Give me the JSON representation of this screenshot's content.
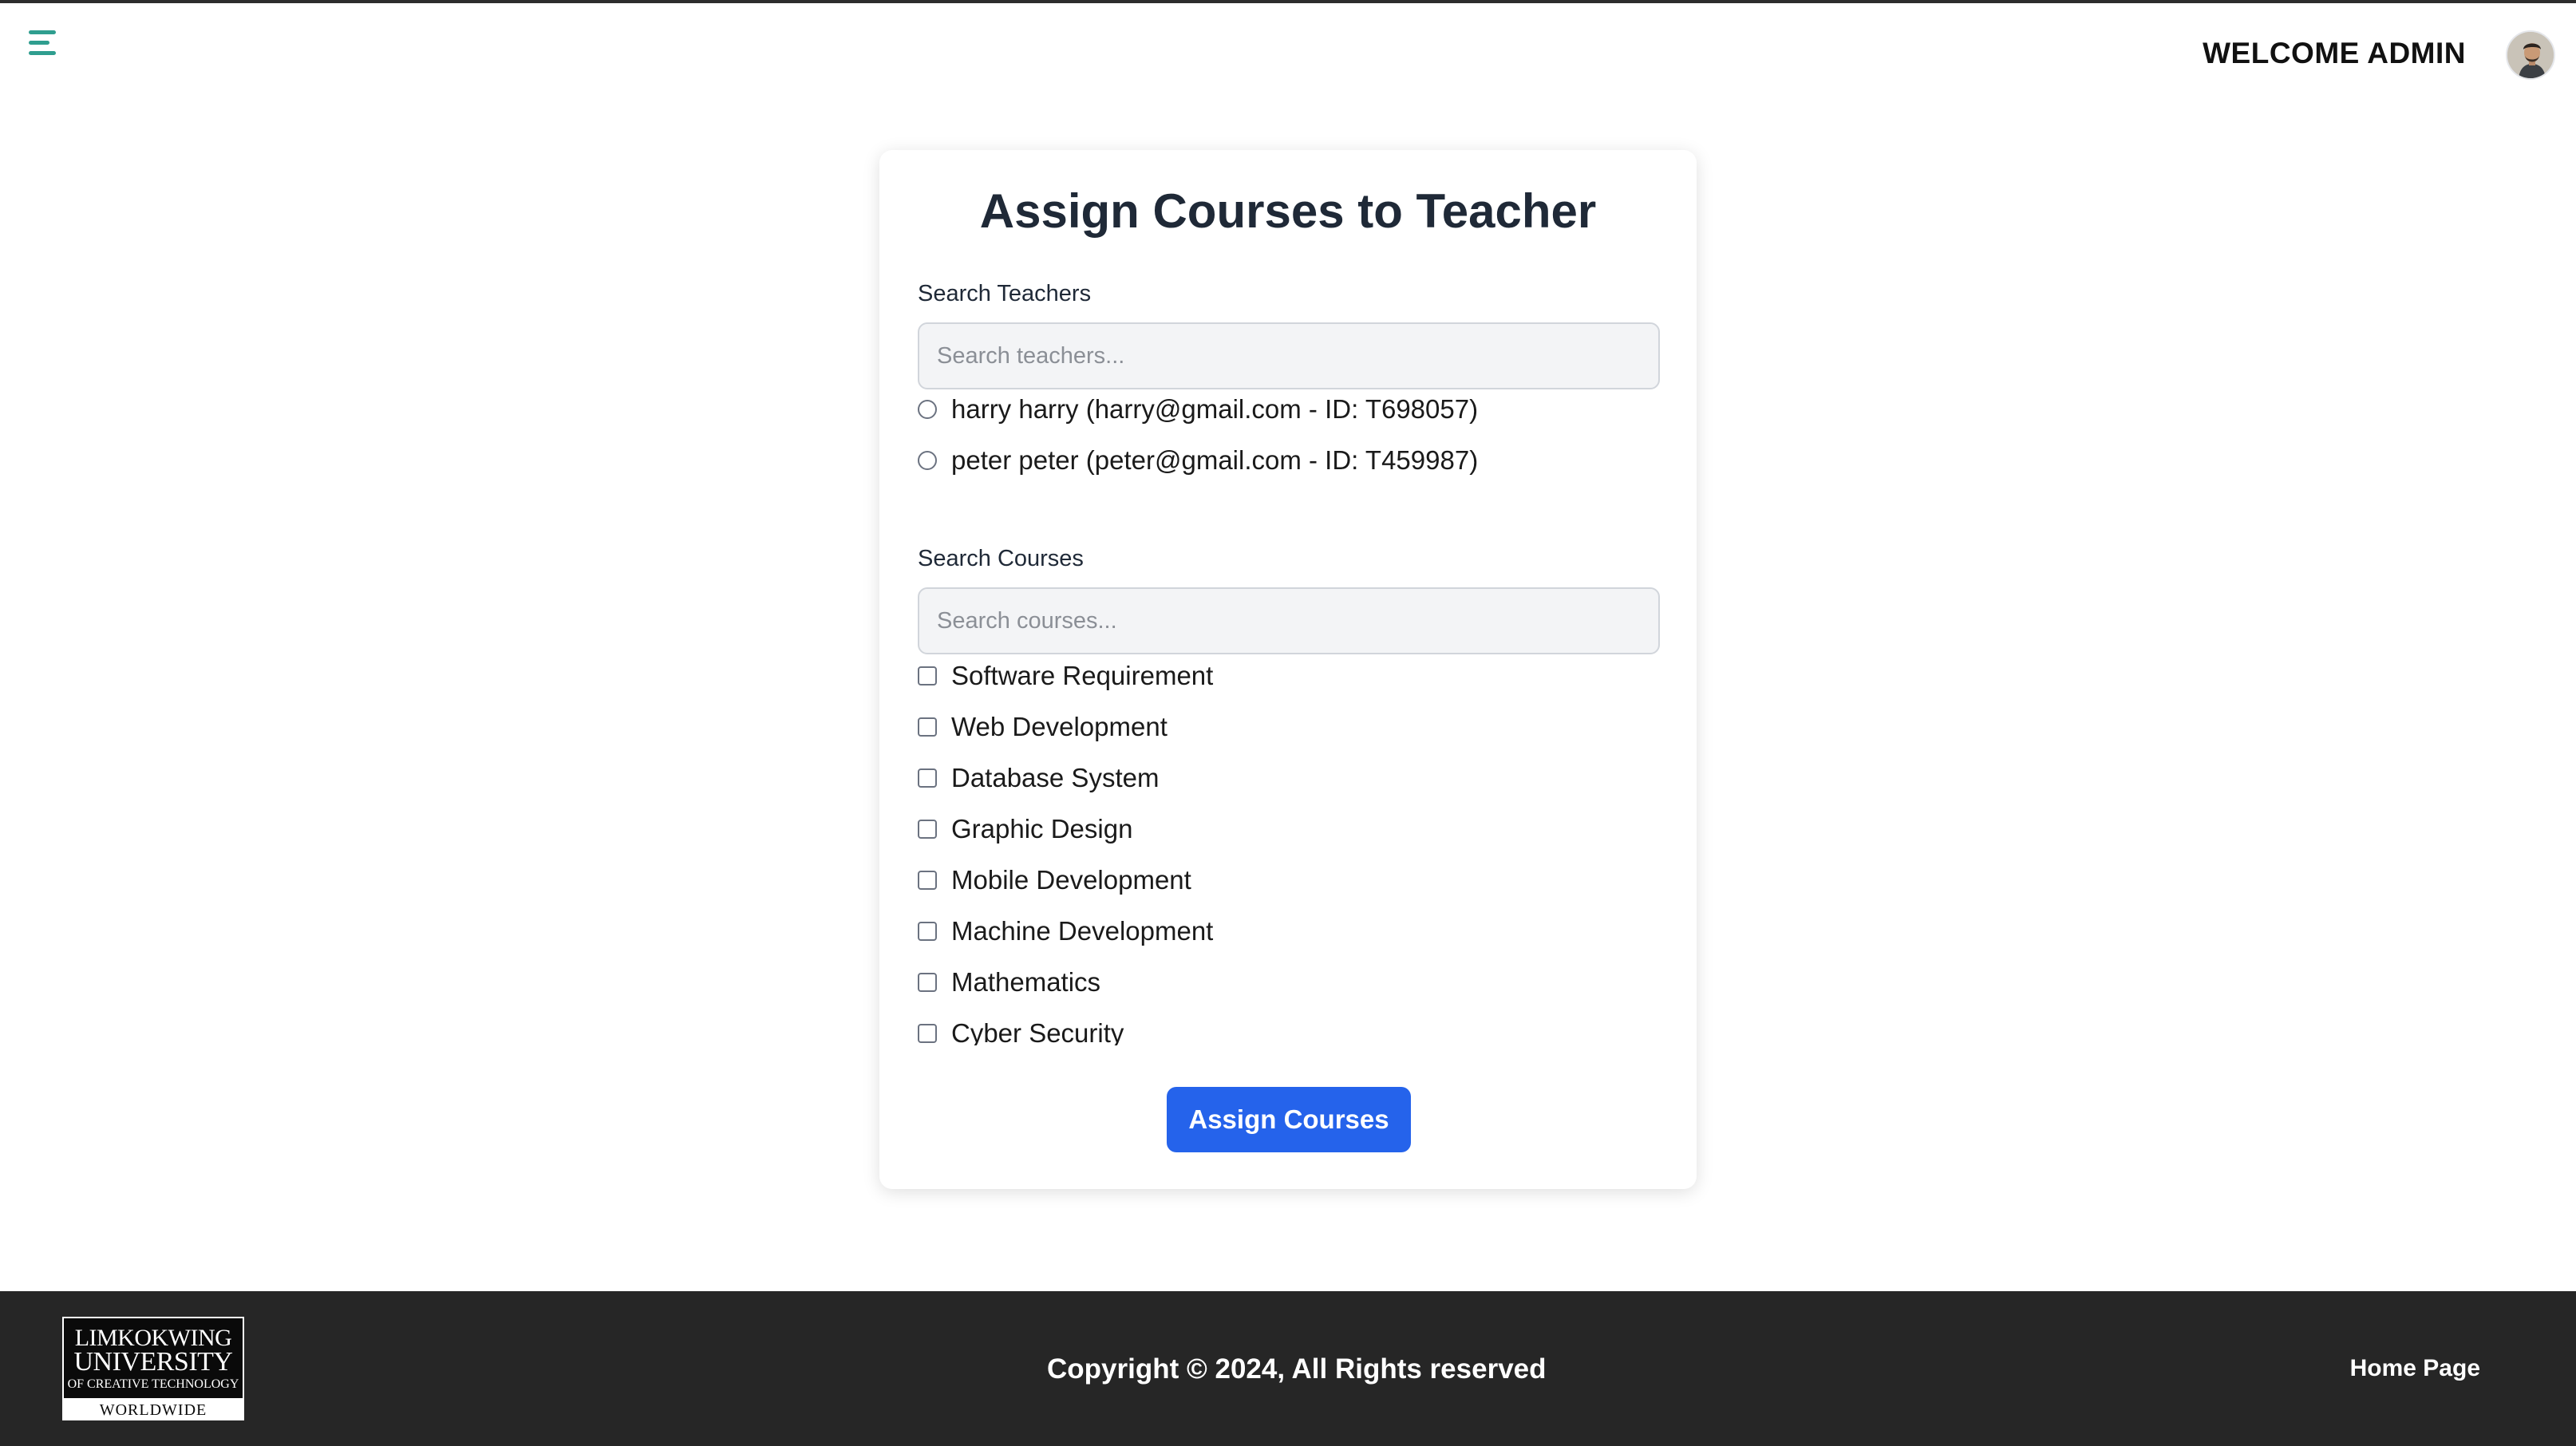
{
  "header": {
    "menu_icon": "hamburger-menu-icon",
    "welcome_text": "WELCOME ADMIN",
    "avatar_icon": "user-avatar"
  },
  "accent_colors": {
    "menu_icon": "#2f9e8f",
    "primary_button": "#2563eb",
    "footer_background": "#262626"
  },
  "form": {
    "title": "Assign Courses to Teacher",
    "teachers": {
      "label": "Search Teachers",
      "placeholder": "Search teachers...",
      "options": [
        {
          "label": "harry harry (harry@gmail.com - ID: T698057)",
          "selected": false
        },
        {
          "label": "peter peter (peter@gmail.com - ID: T459987)",
          "selected": false
        }
      ]
    },
    "courses": {
      "label": "Search Courses",
      "placeholder": "Search courses...",
      "options": [
        {
          "label": "Software Requirement",
          "checked": false
        },
        {
          "label": "Web Development",
          "checked": false
        },
        {
          "label": "Database System",
          "checked": false
        },
        {
          "label": "Graphic Design",
          "checked": false
        },
        {
          "label": "Mobile Development",
          "checked": false
        },
        {
          "label": "Machine Development",
          "checked": false
        },
        {
          "label": "Mathematics",
          "checked": false
        },
        {
          "label": "Cyber Security",
          "checked": false
        }
      ]
    },
    "submit_label": "Assign Courses"
  },
  "footer": {
    "logo": {
      "line1": "LIMKOKWING",
      "line2": "UNIVERSITY",
      "line3": "OF CREATIVE TECHNOLOGY",
      "line4": "WORLDWIDE"
    },
    "copyright": "Copyright © 2024, All Rights reserved",
    "home_link": "Home Page"
  }
}
